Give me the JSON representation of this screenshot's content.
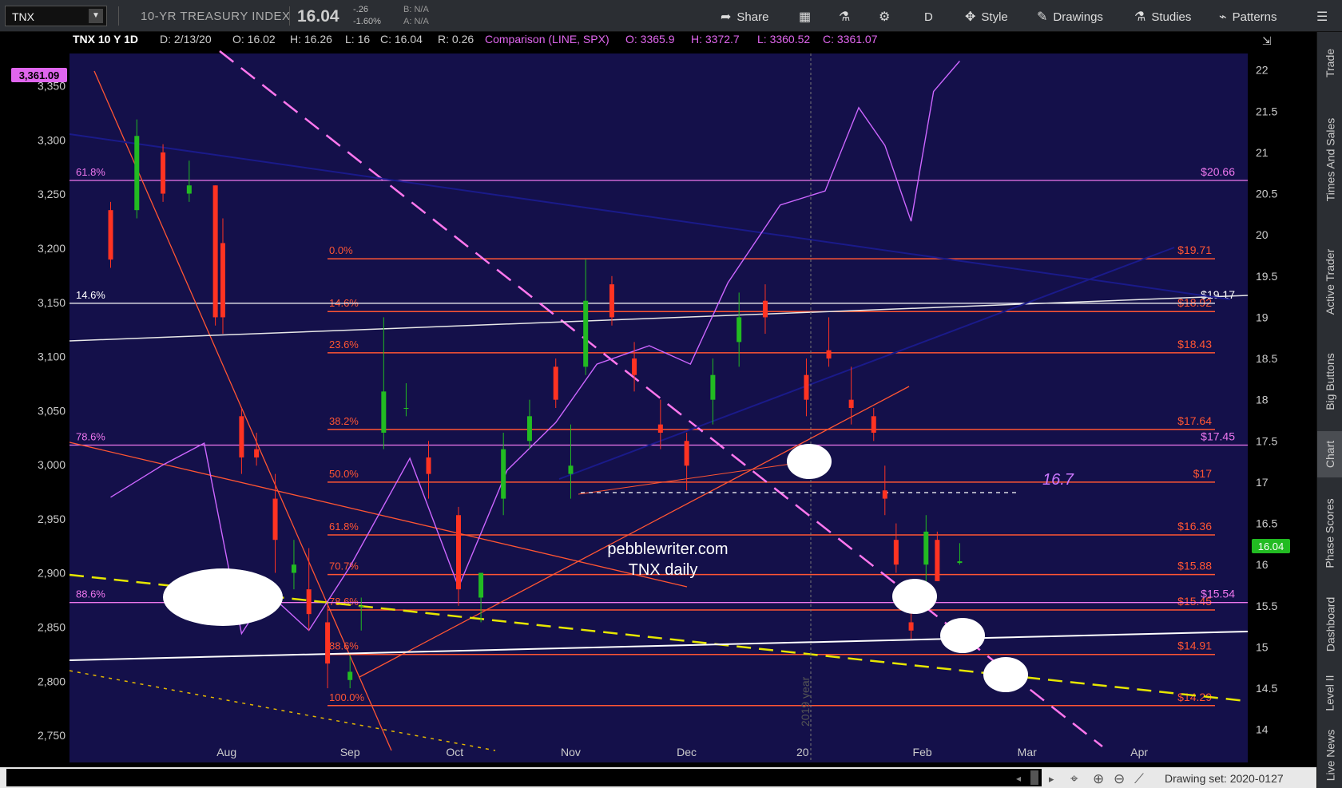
{
  "toolbar": {
    "symbol": "TNX",
    "name": "10-YR TREASURY INDEX",
    "last": "16.04",
    "change": "-.26",
    "change_pct": "-1.60%",
    "bid": "B: N/A",
    "ask": "A: N/A",
    "share": "Share",
    "timeframe": "D",
    "style": "Style",
    "drawings": "Drawings",
    "studies": "Studies",
    "patterns": "Patterns"
  },
  "header": {
    "title": "TNX 10 Y 1D",
    "date": "D: 2/13/20",
    "open": "O: 16.02",
    "high": "H: 16.26",
    "low": "L: 16",
    "close": "C: 16.04",
    "range": "R: 0.26",
    "comparison": "Comparison (LINE, SPX)",
    "c_open": "O: 3365.9",
    "c_high": "H: 3372.7",
    "c_low": "L: 3360.52",
    "c_close": "C: 3361.07"
  },
  "side_tabs": [
    "Trade",
    "Times And Sales",
    "Active Trader",
    "Big Buttons",
    "Chart",
    "Phase Scores",
    "Dashboard",
    "Level II",
    "Live News"
  ],
  "status": {
    "drawing_set": "Drawing set: 2020-0127"
  },
  "chart": {
    "spx_last_label": "3,361.09",
    "tnx_last_label": "16.04",
    "watermark_line1": "pebblewriter.com",
    "watermark_line2": "TNX daily",
    "level_note": "16.7",
    "year_label": "2019 year",
    "colors": {
      "background": "#14104a",
      "up": "#22bb22",
      "down": "#ff3322",
      "spx": "#cc66ff",
      "fib_orange": "#ff5533",
      "fib_magenta": "#ee77ee",
      "trend_dash": "#ff77ee",
      "yellow_dash": "#e6e600",
      "white": "#ffffff"
    },
    "fib_orange": [
      {
        "pct": "0.0%",
        "price": "$19.71",
        "value": 19.71
      },
      {
        "pct": "14.6%",
        "price": "$18.92",
        "value": 19.07
      },
      {
        "pct": "23.6%",
        "price": "$18.43",
        "value": 18.57
      },
      {
        "pct": "38.2%",
        "price": "$17.64",
        "value": 17.64
      },
      {
        "pct": "50.0%",
        "price": "$17",
        "value": 17.0
      },
      {
        "pct": "61.8%",
        "price": "$16.36",
        "value": 16.36
      },
      {
        "pct": "70.7%",
        "price": "$15.88",
        "value": 15.88
      },
      {
        "pct": "78.6%",
        "price": "$15.45",
        "value": 15.45
      },
      {
        "pct": "88.6%",
        "price": "$14.91",
        "value": 14.91
      },
      {
        "pct": "100.0%",
        "price": "$14.29",
        "value": 14.29
      }
    ],
    "fib_magenta": [
      {
        "pct": "61.8%",
        "price": "$20.66",
        "value": 20.66
      },
      {
        "pct": "78.6%",
        "price": "$17.45",
        "value": 17.45
      },
      {
        "pct": "88.6%",
        "price": "$15.54",
        "value": 15.54
      }
    ],
    "fib_white": {
      "pct": "14.6%",
      "price": "$19.17",
      "value": 19.17
    }
  },
  "chart_data": {
    "type": "candlestick",
    "title": "TNX 10 Y 1D",
    "series": [
      {
        "name": "TNX",
        "axis": "right",
        "ylim": [
          13.6,
          22.2
        ]
      },
      {
        "name": "SPX",
        "axis": "left",
        "ylim": [
          2725,
          3380
        ]
      }
    ],
    "x_labels": [
      "Aug",
      "Sep",
      "Oct",
      "Nov",
      "Dec",
      "20",
      "Feb",
      "Mar",
      "Apr"
    ],
    "right_ticks": [
      14,
      14.5,
      15,
      15.5,
      16,
      16.5,
      17,
      17.5,
      18,
      18.5,
      19,
      19.5,
      20,
      20.5,
      21,
      21.5,
      22
    ],
    "left_ticks": [
      "2,750",
      "2,800",
      "2,850",
      "2,900",
      "2,950",
      "3,000",
      "3,050",
      "3,100",
      "3,150",
      "3,200",
      "3,250",
      "3,300",
      "3,350"
    ],
    "tnx_ohlc": [
      [
        "2019-07-01",
        20.3,
        20.4,
        19.6,
        19.7
      ],
      [
        "2019-07-08",
        20.3,
        21.4,
        20.2,
        21.2
      ],
      [
        "2019-07-15",
        21.0,
        21.1,
        20.4,
        20.5
      ],
      [
        "2019-07-22",
        20.5,
        20.9,
        20.4,
        20.6
      ],
      [
        "2019-07-29",
        20.6,
        20.6,
        18.9,
        19.0
      ],
      [
        "2019-07-31",
        19.9,
        20.2,
        18.8,
        19.0
      ],
      [
        "2019-08-05",
        17.8,
        17.9,
        17.1,
        17.3
      ],
      [
        "2019-08-09",
        17.4,
        17.6,
        17.2,
        17.3
      ],
      [
        "2019-08-14",
        16.8,
        17.1,
        15.9,
        16.3
      ],
      [
        "2019-08-19",
        15.9,
        16.3,
        15.7,
        16.0
      ],
      [
        "2019-08-23",
        15.7,
        16.2,
        15.2,
        15.4
      ],
      [
        "2019-08-28",
        15.3,
        15.5,
        14.5,
        14.8
      ],
      [
        "2019-09-03",
        14.6,
        14.9,
        14.5,
        14.7
      ],
      [
        "2019-09-06",
        15.5,
        15.6,
        15.2,
        15.5
      ],
      [
        "2019-09-12",
        17.6,
        19.0,
        17.4,
        18.1
      ],
      [
        "2019-09-18",
        17.9,
        18.2,
        17.8,
        17.9
      ],
      [
        "2019-09-24",
        17.3,
        17.5,
        16.8,
        17.1
      ],
      [
        "2019-10-02",
        16.6,
        16.7,
        15.5,
        15.7
      ],
      [
        "2019-10-08",
        15.6,
        15.9,
        15.3,
        15.9
      ],
      [
        "2019-10-14",
        16.8,
        17.6,
        16.6,
        17.4
      ],
      [
        "2019-10-21",
        17.5,
        18.0,
        17.4,
        17.8
      ],
      [
        "2019-10-28",
        18.4,
        18.5,
        17.9,
        18.0
      ],
      [
        "2019-11-01",
        17.1,
        17.7,
        16.8,
        17.2
      ],
      [
        "2019-11-05",
        18.4,
        19.7,
        18.3,
        19.2
      ],
      [
        "2019-11-12",
        19.4,
        19.5,
        18.9,
        19.0
      ],
      [
        "2019-11-18",
        18.5,
        18.7,
        18.1,
        18.3
      ],
      [
        "2019-11-25",
        17.7,
        18.0,
        17.4,
        17.6
      ],
      [
        "2019-12-02",
        17.5,
        17.6,
        16.9,
        17.2
      ],
      [
        "2019-12-09",
        18.0,
        18.5,
        17.7,
        18.3
      ],
      [
        "2019-12-16",
        18.7,
        19.3,
        18.4,
        19.0
      ],
      [
        "2019-12-23",
        19.2,
        19.4,
        18.8,
        19.0
      ],
      [
        "2020-01-03",
        18.3,
        18.5,
        17.8,
        18.0
      ],
      [
        "2020-01-09",
        18.6,
        19.0,
        18.4,
        18.5
      ],
      [
        "2020-01-15",
        18.0,
        18.4,
        17.7,
        17.9
      ],
      [
        "2020-01-21",
        17.8,
        17.9,
        17.5,
        17.6
      ],
      [
        "2020-01-24",
        16.9,
        17.2,
        16.6,
        16.8
      ],
      [
        "2020-01-27",
        16.3,
        16.5,
        15.9,
        16.0
      ],
      [
        "2020-01-31",
        15.3,
        15.8,
        15.1,
        15.2
      ],
      [
        "2020-02-04",
        16.0,
        16.6,
        15.8,
        16.4
      ],
      [
        "2020-02-07",
        16.3,
        16.4,
        15.8,
        15.8
      ],
      [
        "2020-02-13",
        16.02,
        16.26,
        16.0,
        16.04
      ]
    ],
    "spx_close": [
      [
        "2019-07-01",
        2970
      ],
      [
        "2019-07-15",
        3000
      ],
      [
        "2019-07-26",
        3020
      ],
      [
        "2019-08-05",
        2844
      ],
      [
        "2019-08-12",
        2882
      ],
      [
        "2019-08-23",
        2847
      ],
      [
        "2019-09-03",
        2906
      ],
      [
        "2019-09-19",
        3006
      ],
      [
        "2019-10-02",
        2887
      ],
      [
        "2019-10-15",
        2995
      ],
      [
        "2019-10-28",
        3039
      ],
      [
        "2019-11-08",
        3093
      ],
      [
        "2019-11-22",
        3110
      ],
      [
        "2019-12-03",
        3093
      ],
      [
        "2019-12-13",
        3168
      ],
      [
        "2019-12-27",
        3240
      ],
      [
        "2020-01-08",
        3253
      ],
      [
        "2020-01-17",
        3330
      ],
      [
        "2020-01-24",
        3295
      ],
      [
        "2020-01-31",
        3225
      ],
      [
        "2020-02-06",
        3345
      ],
      [
        "2020-02-13",
        3373
      ]
    ]
  }
}
